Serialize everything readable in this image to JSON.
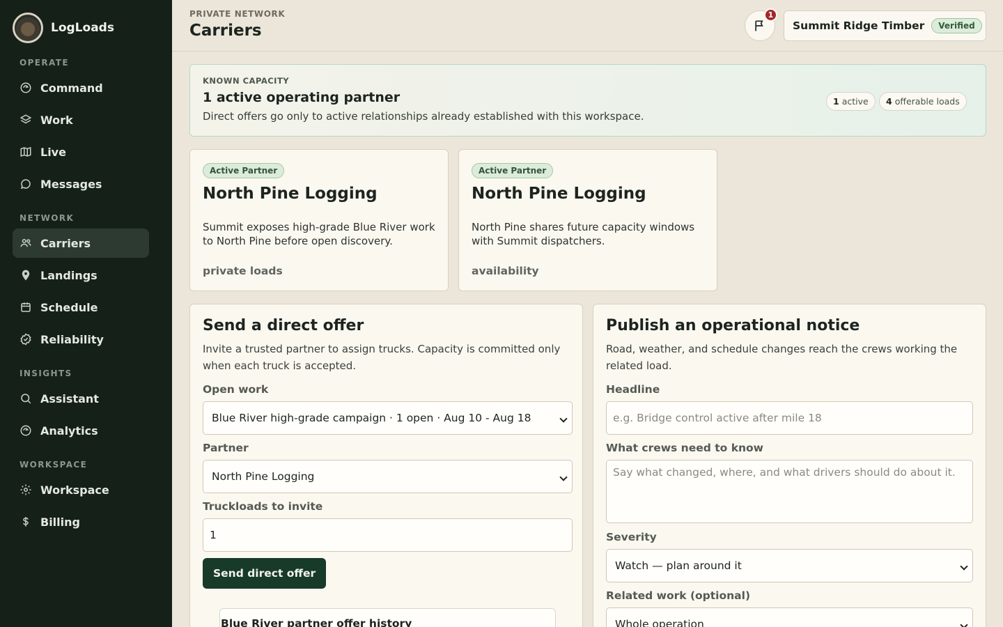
{
  "brand": {
    "name": "LogLoads"
  },
  "sidebar": {
    "sections": [
      {
        "label": "OPERATE"
      },
      {
        "label": "NETWORK"
      },
      {
        "label": "INSIGHTS"
      },
      {
        "label": "WORKSPACE"
      }
    ],
    "items": [
      {
        "label": "Command",
        "icon": "command-icon"
      },
      {
        "label": "Work",
        "icon": "layers-icon"
      },
      {
        "label": "Live",
        "icon": "map-icon"
      },
      {
        "label": "Messages",
        "icon": "message-icon"
      },
      {
        "label": "Carriers",
        "icon": "users-icon",
        "active": true
      },
      {
        "label": "Landings",
        "icon": "pin-icon"
      },
      {
        "label": "Schedule",
        "icon": "calendar-icon"
      },
      {
        "label": "Reliability",
        "icon": "badge-check-icon"
      },
      {
        "label": "Assistant",
        "icon": "search-icon"
      },
      {
        "label": "Analytics",
        "icon": "analytics-icon"
      },
      {
        "label": "Workspace",
        "icon": "gear-icon"
      },
      {
        "label": "Billing",
        "icon": "dollar-icon"
      }
    ]
  },
  "header": {
    "eyebrow": "PRIVATE NETWORK",
    "title": "Carriers",
    "notification_count": "1",
    "org_name": "Summit Ridge Timber",
    "org_status": "Verified"
  },
  "capacity": {
    "eyebrow": "KNOWN CAPACITY",
    "title": "1 active operating partner",
    "description": "Direct offers go only to active relationships already established with this workspace.",
    "active_count": "1",
    "active_label": "active",
    "loads_count": "4",
    "loads_label": "offerable loads"
  },
  "partners": [
    {
      "tag": "Active Partner",
      "name": "North Pine Logging",
      "description": "Summit exposes high-grade Blue River work to North Pine before open discovery.",
      "footer": "private loads"
    },
    {
      "tag": "Active Partner",
      "name": "North Pine Logging",
      "description": "North Pine shares future capacity windows with Summit dispatchers.",
      "footer": "availability"
    }
  ],
  "direct_offer": {
    "title": "Send a direct offer",
    "description": "Invite a trusted partner to assign trucks. Capacity is committed only when each truck is accepted.",
    "open_work_label": "Open work",
    "open_work_value": "Blue River high-grade campaign · 1 open · Aug 10 - Aug 18",
    "partner_label": "Partner",
    "partner_value": "North Pine Logging",
    "truckloads_label": "Truckloads to invite",
    "truckloads_value": "1",
    "submit_label": "Send direct offer",
    "history_title": "Blue River partner offer history"
  },
  "notice": {
    "title": "Publish an operational notice",
    "description": "Road, weather, and schedule changes reach the crews working the related load.",
    "headline_label": "Headline",
    "headline_placeholder": "e.g. Bridge control active after mile 18",
    "body_label": "What crews need to know",
    "body_placeholder": "Say what changed, where, and what drivers should do about it.",
    "severity_label": "Severity",
    "severity_value": "Watch — plan around it",
    "related_label": "Related work (optional)",
    "related_value": "Whole operation"
  },
  "colors": {
    "sidebar_bg": "#152019",
    "active_item_bg": "#2d3a32",
    "page_bg": "#ece6da",
    "card_bg": "#fbf8f0",
    "primary_button": "#183a28",
    "badge_red": "#a3262a",
    "verified_green": "#dcecdb"
  }
}
